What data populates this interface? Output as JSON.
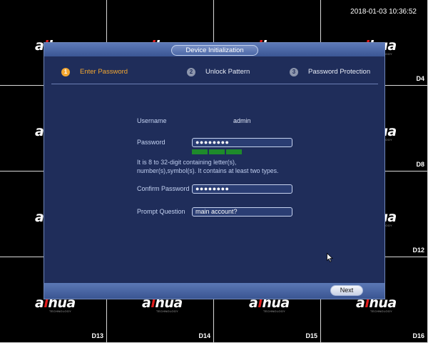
{
  "clock": "2018-01-03 10:36:52",
  "logo": {
    "prefix": "a",
    "mark": "l",
    "suffix": "hua",
    "tagline": "TECHNOLOGY"
  },
  "cameras": [
    "",
    "",
    "",
    "D4",
    "",
    "",
    "",
    "D8",
    "",
    "",
    "",
    "D12",
    "D13",
    "D14",
    "D15",
    "D16"
  ],
  "dialog": {
    "title": "Device Initialization",
    "steps": [
      {
        "num": "1",
        "label": "Enter Password"
      },
      {
        "num": "2",
        "label": "Unlock Pattern"
      },
      {
        "num": "3",
        "label": "Password Protection"
      }
    ],
    "username_label": "Username",
    "username_value": "admin",
    "password_label": "Password",
    "password_value": "●●●●●●●●",
    "password_hint": "It is 8 to 32-digit containing letter(s), number(s),symbol(s). It contains at least two types.",
    "confirm_label": "Confirm Password",
    "confirm_value": "●●●●●●●●",
    "prompt_label": "Prompt Question",
    "prompt_value": "main account?",
    "next_label": "Next"
  },
  "colors": {
    "dialog_bg": "#1f2d5a",
    "accent": "#f3a731",
    "strength": "#1e8a2b"
  }
}
